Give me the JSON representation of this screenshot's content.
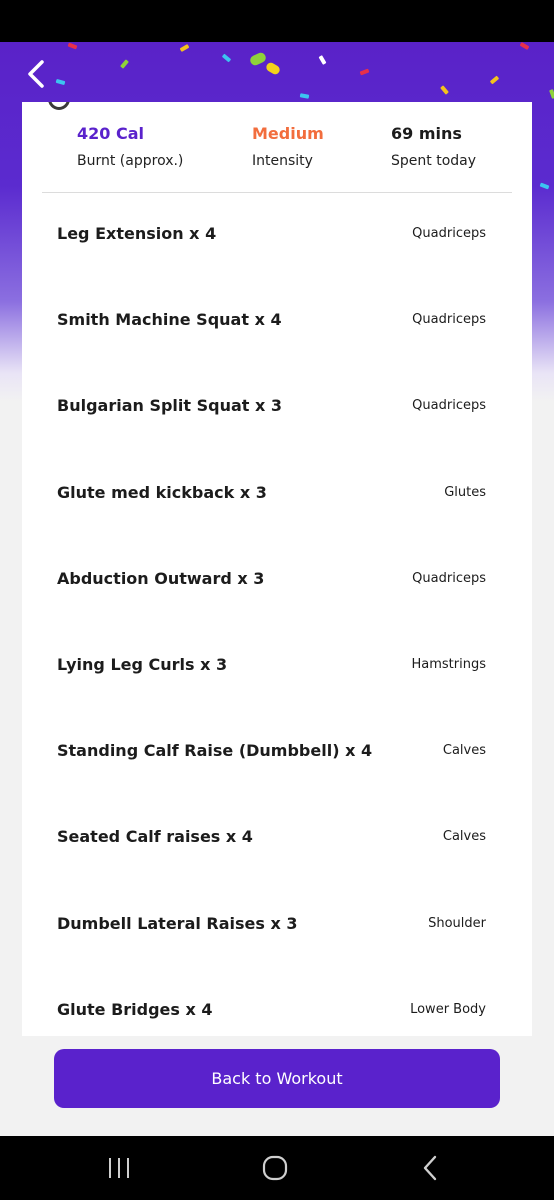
{
  "header": {
    "back_icon": "chevron-left-icon"
  },
  "stats": [
    {
      "value": "420 Cal",
      "label": "Burnt (approx.)",
      "color": "#5a22cc"
    },
    {
      "value": "Medium",
      "label": "Intensity",
      "color": "#f26d3d"
    },
    {
      "value": "69 mins",
      "label": "Spent today",
      "color": "#1c1c1c"
    }
  ],
  "exercises": [
    {
      "name": "Leg Extension x 4",
      "muscle": "Quadriceps"
    },
    {
      "name": "Smith Machine Squat x 4",
      "muscle": "Quadriceps"
    },
    {
      "name": "Bulgarian Split Squat x 3",
      "muscle": "Quadriceps"
    },
    {
      "name": "Glute med kickback x 3",
      "muscle": "Glutes"
    },
    {
      "name": "Abduction Outward x 3",
      "muscle": "Quadriceps"
    },
    {
      "name": "Lying Leg Curls x 3",
      "muscle": "Hamstrings"
    },
    {
      "name": "Standing Calf Raise (Dumbbell) x 4",
      "muscle": "Calves"
    },
    {
      "name": "Seated Calf raises x 4",
      "muscle": "Calves"
    },
    {
      "name": "Dumbell Lateral Raises x 3",
      "muscle": "Shoulder"
    },
    {
      "name": "Glute Bridges x 4",
      "muscle": "Lower Body"
    }
  ],
  "footer": {
    "button_label": "Back to Workout"
  },
  "colors": {
    "brand": "#5a22cc",
    "accent": "#f26d3d"
  },
  "system_nav": {
    "recents_icon": "recents-icon",
    "home_icon": "home-icon",
    "back_icon": "back-icon"
  }
}
